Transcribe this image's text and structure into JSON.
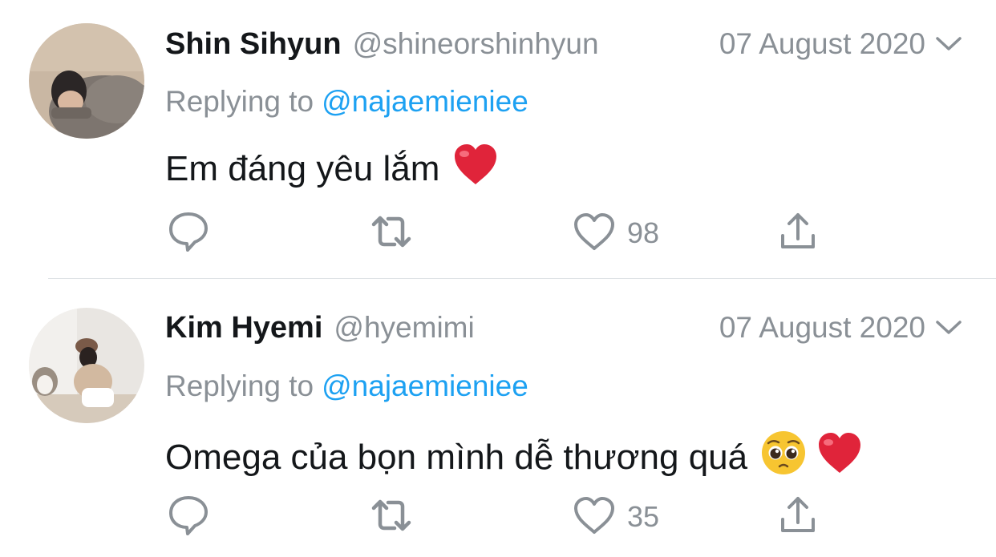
{
  "colors": {
    "text": "#14171a",
    "muted": "#8a9096",
    "link": "#1da1f2",
    "divider": "#dfe3e6",
    "heart_emoji": "#e0243a"
  },
  "tweets": [
    {
      "display_name": "Shin Sihyun",
      "handle": "@shineorshinhyun",
      "date": "07 August 2020",
      "replying_prefix": "Replying to",
      "replying_to": "@najaemieniee",
      "text": "Em đáng yêu lắm",
      "emojis": [
        "red-heart-emoji"
      ],
      "like_count": "98",
      "icons": [
        "reply-icon",
        "retweet-icon",
        "like-icon",
        "share-icon",
        "chevron-down-icon"
      ]
    },
    {
      "display_name": "Kim Hyemi",
      "handle": "@hyemimi",
      "date": "07 August 2020",
      "replying_prefix": "Replying to",
      "replying_to": "@najaemieniee",
      "text": "Omega của bọn mình dễ thương quá",
      "emojis": [
        "pleading-face-emoji",
        "red-heart-emoji"
      ],
      "like_count": "35",
      "icons": [
        "reply-icon",
        "retweet-icon",
        "like-icon",
        "share-icon",
        "chevron-down-icon"
      ]
    }
  ]
}
